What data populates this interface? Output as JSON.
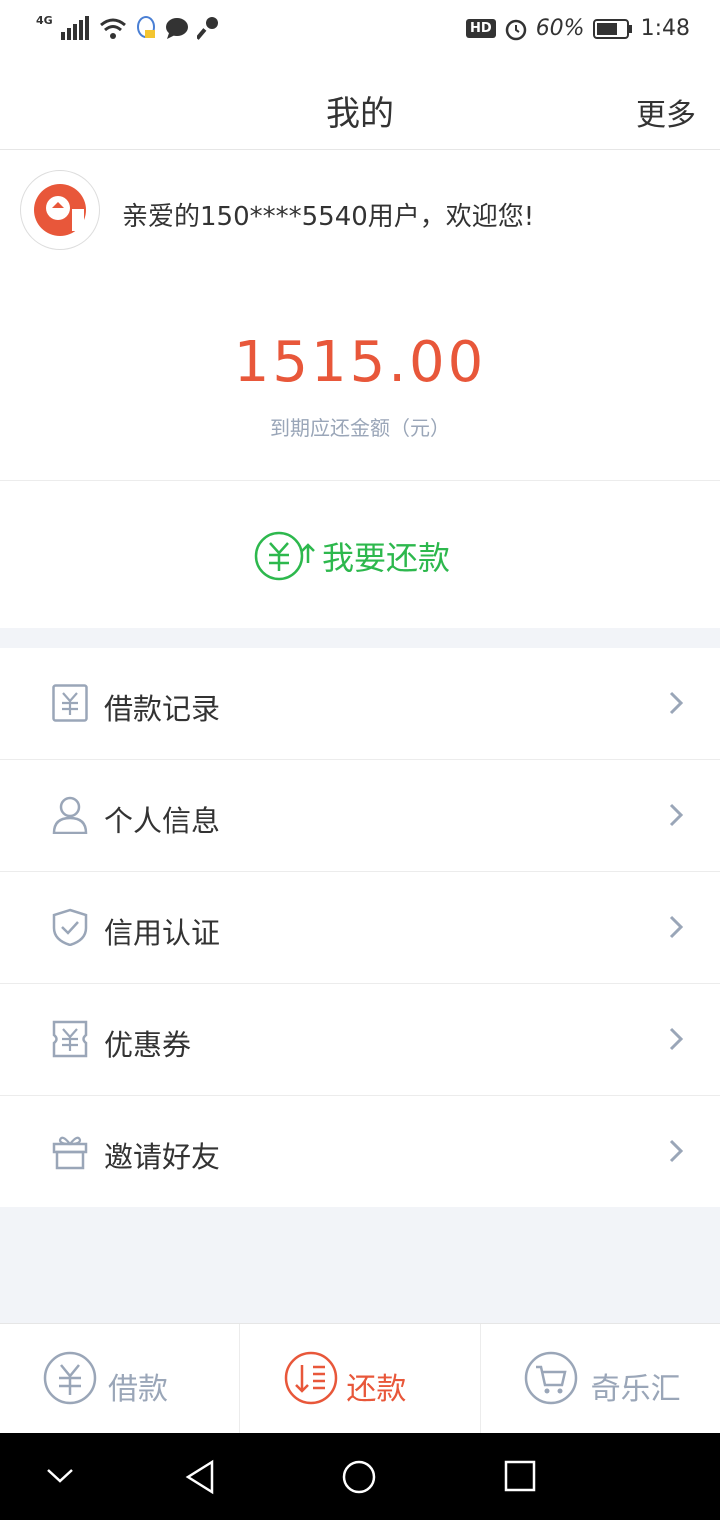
{
  "status_bar": {
    "network": "4G",
    "hd": "HD",
    "battery": "60%",
    "time": "1:48"
  },
  "header": {
    "title": "我的",
    "more": "更多"
  },
  "user": {
    "greeting": "亲爱的150****5540用户，欢迎您!"
  },
  "due": {
    "amount": "1515.00",
    "label": "到期应还金额（元）"
  },
  "repay_button": "我要还款",
  "menu": [
    {
      "label": "借款记录",
      "icon": "yuan-receipt-icon"
    },
    {
      "label": "个人信息",
      "icon": "user-icon"
    },
    {
      "label": "信用认证",
      "icon": "shield-check-icon"
    },
    {
      "label": "优惠券",
      "icon": "coupon-icon"
    },
    {
      "label": "邀请好友",
      "icon": "gift-icon"
    }
  ],
  "tabbar": [
    {
      "label": "借款",
      "icon": "yuan-circle-icon",
      "active": false
    },
    {
      "label": "还款",
      "icon": "repay-icon",
      "active": true
    },
    {
      "label": "奇乐汇",
      "icon": "cart-icon",
      "active": false
    }
  ],
  "colors": {
    "accent": "#e8573a",
    "green": "#2db84d",
    "icon_gray": "#9aa6b8"
  }
}
